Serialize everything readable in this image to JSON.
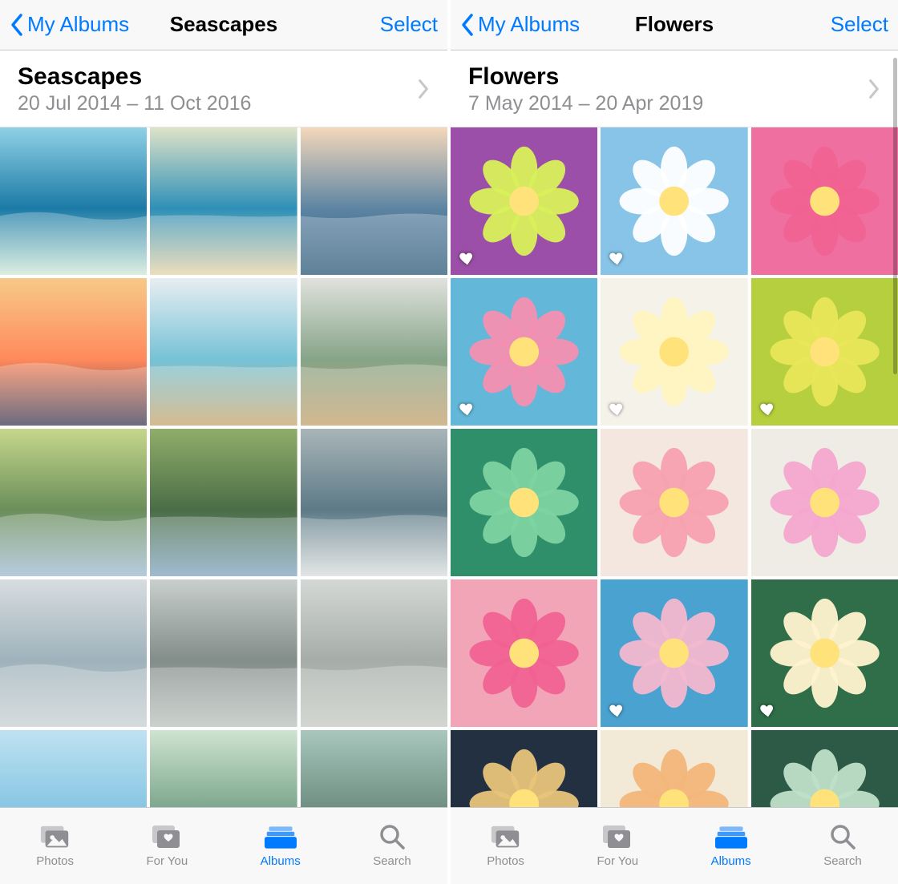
{
  "colors": {
    "tint": "#007aff",
    "grey": "#8e8e93"
  },
  "panes": [
    {
      "nav": {
        "back_label": "My Albums",
        "title": "Seascapes",
        "action": "Select"
      },
      "header": {
        "title": "Seascapes",
        "date_range": "20 Jul 2014 – 11 Oct 2016"
      },
      "thumbs": [
        {
          "fav": false
        },
        {
          "fav": false
        },
        {
          "fav": false
        },
        {
          "fav": false
        },
        {
          "fav": false
        },
        {
          "fav": false
        },
        {
          "fav": false
        },
        {
          "fav": false
        },
        {
          "fav": false
        },
        {
          "fav": false
        },
        {
          "fav": false
        },
        {
          "fav": false
        },
        {
          "fav": false
        },
        {
          "fav": false
        },
        {
          "fav": false
        }
      ]
    },
    {
      "nav": {
        "back_label": "My Albums",
        "title": "Flowers",
        "action": "Select"
      },
      "header": {
        "title": "Flowers",
        "date_range": "7 May 2014 – 20 Apr 2019"
      },
      "thumbs": [
        {
          "fav": true
        },
        {
          "fav": true
        },
        {
          "fav": false
        },
        {
          "fav": true
        },
        {
          "fav": true
        },
        {
          "fav": true
        },
        {
          "fav": false
        },
        {
          "fav": false
        },
        {
          "fav": false
        },
        {
          "fav": false
        },
        {
          "fav": true
        },
        {
          "fav": true
        },
        {
          "fav": false
        },
        {
          "fav": false
        },
        {
          "fav": false
        }
      ]
    }
  ],
  "tabs": [
    {
      "label": "Photos",
      "active": false
    },
    {
      "label": "For You",
      "active": false
    },
    {
      "label": "Albums",
      "active": true
    },
    {
      "label": "Search",
      "active": false
    }
  ]
}
